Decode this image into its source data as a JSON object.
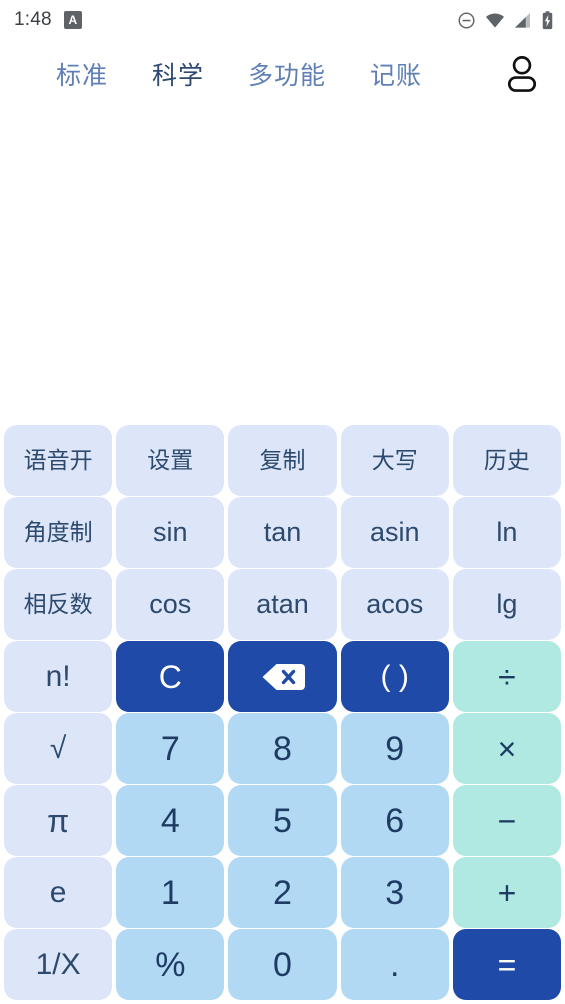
{
  "status_bar": {
    "time": "1:48",
    "app_badge_letter": "A",
    "icons": [
      "do-not-disturb-icon",
      "wifi-icon",
      "cellular-signal-icon",
      "battery-charging-icon"
    ]
  },
  "tab_bar": {
    "tabs": [
      {
        "label": "标准",
        "active": false
      },
      {
        "label": "科学",
        "active": true
      },
      {
        "label": "多功能",
        "active": false
      },
      {
        "label": "记账",
        "active": false
      }
    ],
    "account_icon": "account-person-icon"
  },
  "display": {
    "expression": "",
    "result": ""
  },
  "keypad": {
    "rows": [
      [
        {
          "label": "语音开",
          "name": "voice-on-key",
          "style": "func-zh"
        },
        {
          "label": "设置",
          "name": "settings-key",
          "style": "func-zh"
        },
        {
          "label": "复制",
          "name": "copy-key",
          "style": "func-zh"
        },
        {
          "label": "大写",
          "name": "uppercase-key",
          "style": "func-zh"
        },
        {
          "label": "历史",
          "name": "history-key",
          "style": "func-zh"
        }
      ],
      [
        {
          "label": "角度制",
          "name": "angle-mode-key",
          "style": "side-zh"
        },
        {
          "label": "sin",
          "name": "sin-key",
          "style": "func"
        },
        {
          "label": "tan",
          "name": "tan-key",
          "style": "func"
        },
        {
          "label": "asin",
          "name": "asin-key",
          "style": "func"
        },
        {
          "label": "ln",
          "name": "ln-key",
          "style": "func"
        }
      ],
      [
        {
          "label": "相反数",
          "name": "negate-key",
          "style": "side-zh"
        },
        {
          "label": "cos",
          "name": "cos-key",
          "style": "func"
        },
        {
          "label": "atan",
          "name": "atan-key",
          "style": "func"
        },
        {
          "label": "acos",
          "name": "acos-key",
          "style": "func"
        },
        {
          "label": "lg",
          "name": "lg-key",
          "style": "func"
        }
      ],
      [
        {
          "label": "n!",
          "name": "factorial-key",
          "style": "side"
        },
        {
          "label": "C",
          "name": "clear-key",
          "style": "accent"
        },
        {
          "label": "",
          "name": "backspace-key",
          "style": "accent-icon",
          "icon": "backspace-icon"
        },
        {
          "label": "( )",
          "name": "parentheses-key",
          "style": "accent"
        },
        {
          "label": "÷",
          "name": "divide-key",
          "style": "op"
        }
      ],
      [
        {
          "label": "√",
          "name": "square-root-key",
          "style": "side-sqrt"
        },
        {
          "label": "7",
          "name": "digit-7-key",
          "style": "digit"
        },
        {
          "label": "8",
          "name": "digit-8-key",
          "style": "digit"
        },
        {
          "label": "9",
          "name": "digit-9-key",
          "style": "digit"
        },
        {
          "label": "×",
          "name": "multiply-key",
          "style": "op"
        }
      ],
      [
        {
          "label": "π",
          "name": "pi-key",
          "style": "side-pi"
        },
        {
          "label": "4",
          "name": "digit-4-key",
          "style": "digit"
        },
        {
          "label": "5",
          "name": "digit-5-key",
          "style": "digit"
        },
        {
          "label": "6",
          "name": "digit-6-key",
          "style": "digit"
        },
        {
          "label": "−",
          "name": "minus-key",
          "style": "op"
        }
      ],
      [
        {
          "label": "e",
          "name": "euler-e-key",
          "style": "side"
        },
        {
          "label": "1",
          "name": "digit-1-key",
          "style": "digit"
        },
        {
          "label": "2",
          "name": "digit-2-key",
          "style": "digit"
        },
        {
          "label": "3",
          "name": "digit-3-key",
          "style": "digit"
        },
        {
          "label": "+",
          "name": "plus-key",
          "style": "op"
        }
      ],
      [
        {
          "label": "1/X",
          "name": "reciprocal-key",
          "style": "side"
        },
        {
          "label": "%",
          "name": "percent-key",
          "style": "digit"
        },
        {
          "label": "0",
          "name": "digit-0-key",
          "style": "digit"
        },
        {
          "label": ".",
          "name": "decimal-point-key",
          "style": "digit-dot"
        },
        {
          "label": "=",
          "name": "equals-key",
          "style": "accent"
        }
      ]
    ]
  },
  "colors": {
    "accent_blue": "#1f4aa8",
    "operator_mint": "#b0e8e2",
    "digit_blue": "#b2d9f4",
    "function_periwinkle": "#dde6f8",
    "text_navy": "#1e3c63",
    "tab_inactive": "#5f7fb5",
    "tab_active": "#2d4a6e"
  }
}
